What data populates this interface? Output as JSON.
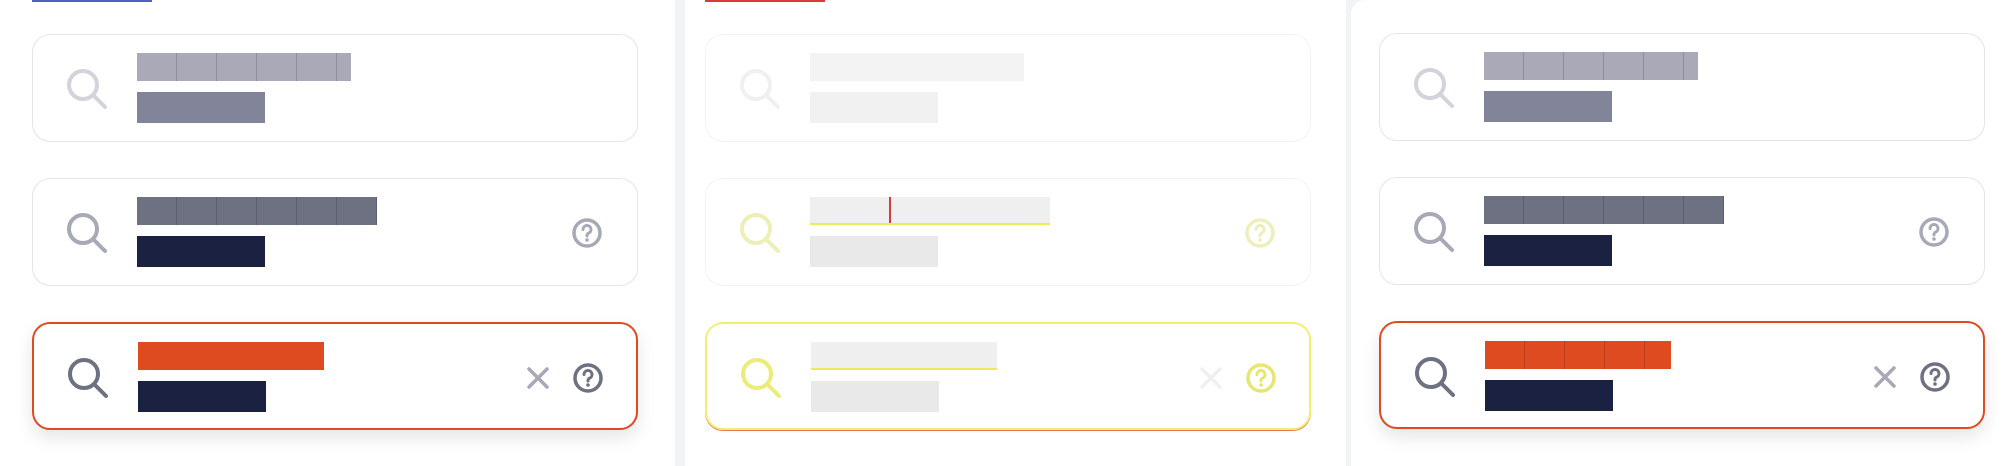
{
  "colors": {
    "panel_bg": "#ffffff",
    "page_bg": "#f2f3f5",
    "border_default": "#e4e5ea",
    "border_active": "#df4b21",
    "accent_orange": "#df4b21",
    "placeholder_gray": "#a9a9b8",
    "label_gray": "#82859a",
    "label_dark": "#1b2140",
    "icon_light": "#d2d3db",
    "icon_mid": "#a8a9b7",
    "icon_dark": "#6e7182",
    "tab_indicator_blue": "#5460c0",
    "tab_indicator_red": "#d93a3a"
  },
  "icons": {
    "search": "search-icon",
    "clear": "close-icon",
    "help": "help-circle-icon"
  },
  "columns": [
    {
      "name": "default"
    },
    {
      "name": "disabled"
    },
    {
      "name": "alternate"
    }
  ]
}
